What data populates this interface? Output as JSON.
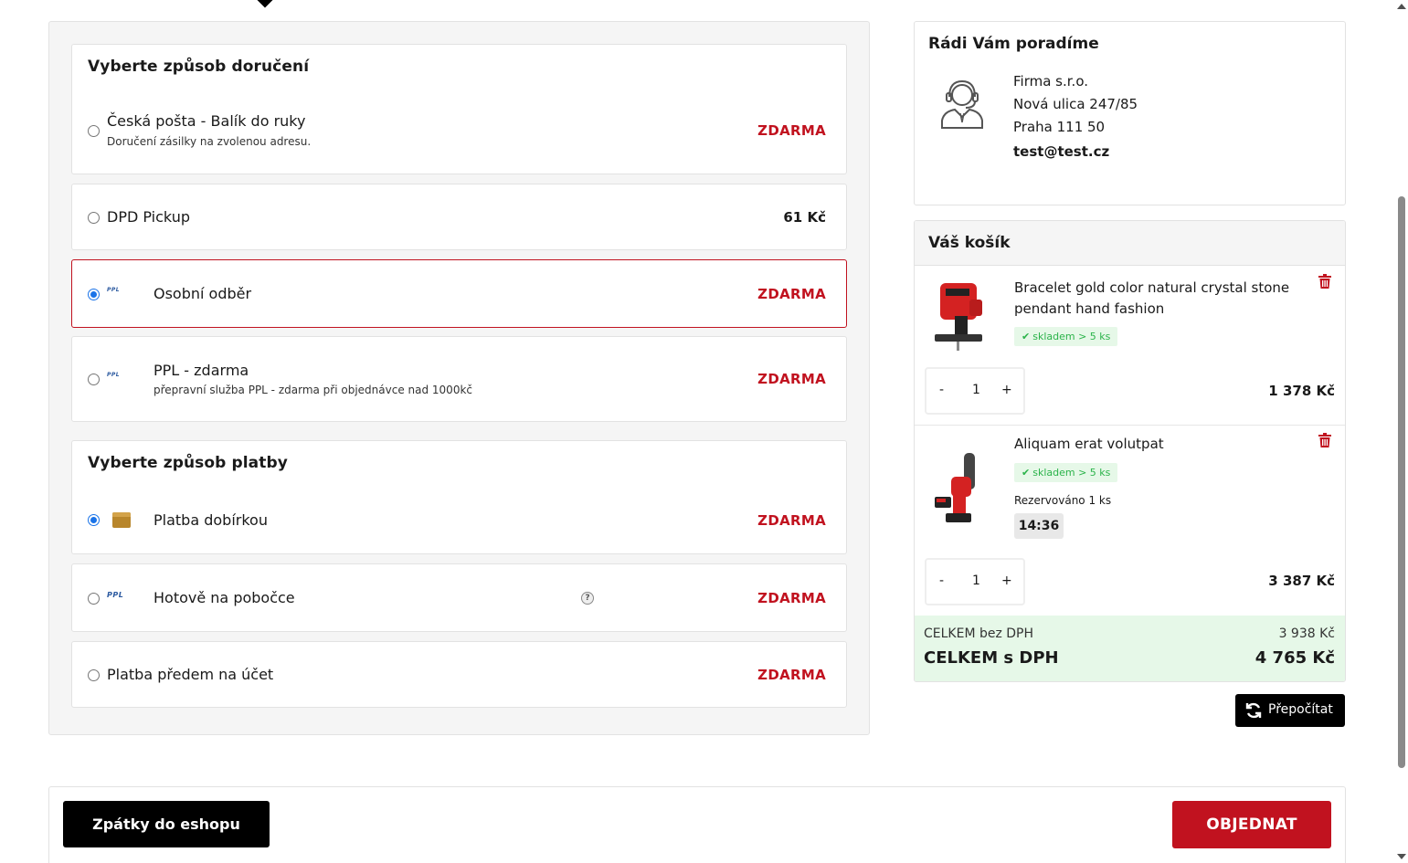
{
  "delivery": {
    "heading": "Vyberte způsob doručení",
    "options": [
      {
        "title": "Česká pošta - Balík do ruky",
        "description": "Doručení zásilky na zvolenou adresu.",
        "price": "ZDARMA",
        "selected": false
      },
      {
        "title": "DPD Pickup",
        "price": "61 Kč",
        "selected": false
      },
      {
        "title": "Osobní odběr",
        "logo": "PPL",
        "price": "ZDARMA",
        "selected": true
      },
      {
        "title": "PPL - zdarma",
        "logo": "PPL",
        "description": "přepravní služba PPL - zdarma při objednávce nad 1000kč",
        "price": "ZDARMA",
        "selected": false
      }
    ]
  },
  "payment": {
    "heading": "Vyberte způsob platby",
    "options": [
      {
        "title": "Platba dobírkou",
        "icon": "wallet-icon",
        "price": "ZDARMA",
        "selected": true
      },
      {
        "title": "Hotově na pobočce",
        "logo": "PPL",
        "help": "?",
        "price": "ZDARMA",
        "selected": false
      },
      {
        "title": "Platba předem na účet",
        "price": "ZDARMA",
        "selected": false
      }
    ]
  },
  "help": {
    "heading": "Rádi Vám poradíme",
    "company": "Firma s.r.o.",
    "street": "Nová ulica 247/85",
    "city": "Praha 111 50",
    "email": "test@test.cz"
  },
  "cart": {
    "heading": "Váš košík",
    "items": [
      {
        "name": "Bracelet gold color natural crystal stone pendant hand fashion",
        "stock": "skladem > 5 ks",
        "qty_minus": "-",
        "qty": "1",
        "qty_plus": "+",
        "price": "1 378 Kč",
        "image": "jigsaw"
      },
      {
        "name": "Aliquam erat volutpat",
        "stock": "skladem > 5 ks",
        "reserved": "Rezervováno 1 ks",
        "timer": "14:36",
        "qty_minus": "-",
        "qty": "1",
        "qty_plus": "+",
        "price": "3 387 Kč",
        "image": "chainsaw"
      }
    ],
    "total_without_vat_label": "CELKEM bez DPH",
    "total_without_vat": "3 938 Kč",
    "total_with_vat_label": "CELKEM s DPH",
    "total_with_vat": "4 765 Kč",
    "recalculate_label": "Přepočítat"
  },
  "footer": {
    "back_label": "Zpátky do eshopu",
    "order_label": "OBJEDNAT"
  },
  "colors": {
    "accent_red": "#c1121f",
    "stock_green": "#2bb34a",
    "radio_blue": "#1a73e8"
  }
}
